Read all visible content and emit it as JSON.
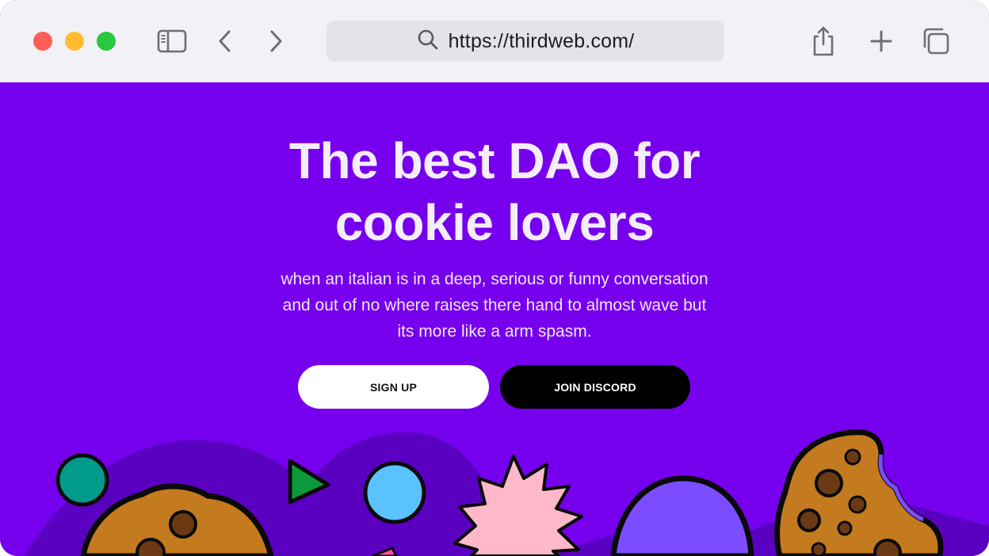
{
  "browser": {
    "url": "https://thirdweb.com/",
    "icons": {
      "close": "red-close-icon",
      "minimize": "yellow-minimize-icon",
      "zoom": "green-zoom-icon",
      "sidebar": "sidebar-icon",
      "back": "chevron-left-icon",
      "forward": "chevron-right-icon",
      "search": "search-icon",
      "share": "share-icon",
      "new_tab": "plus-icon",
      "tabs": "tabs-overview-icon"
    }
  },
  "hero": {
    "headline_line1": "The best DAO for",
    "headline_line2": "cookie lovers",
    "subtitle": "when an italian is in a deep, serious or funny conversation and out of no where raises there hand to almost wave but its more like a arm spasm.",
    "buttons": {
      "signup": "SIGN UP",
      "discord": "JOIN DISCORD"
    }
  },
  "colors": {
    "background": "#7600ee",
    "hill": "#5a00c0",
    "cookie": "#c47a1e",
    "chip": "#6b3a14",
    "teal_circle": "#009b8a",
    "blue_circle": "#5ac3ff",
    "green_triangle": "#0b9a3a",
    "pink_star": "#ffb8ca",
    "lilac_blob": "#7b4dff"
  }
}
